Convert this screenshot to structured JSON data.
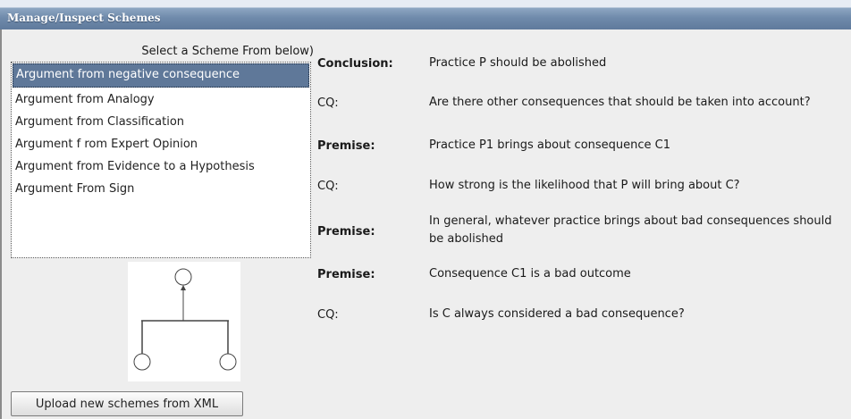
{
  "window": {
    "title": "Manage/Inspect Schemes"
  },
  "scheme_list": {
    "label": "Select a Scheme From below)",
    "items": [
      "Argument from negative consequence",
      "Argument from Analogy",
      "Argument from Classification",
      "Argument f rom Expert Opinion",
      "Argument from Evidence to a Hypothesis",
      "Argument From Sign"
    ],
    "selected_index": 0
  },
  "upload_button": {
    "label": "Upload new schemes from XML"
  },
  "scheme_details": [
    {
      "label": "Conclusion:",
      "text": "Practice P should be abolished",
      "bold": true
    },
    {
      "label": "CQ:",
      "text": "Are there other consequences that should be taken into account?",
      "bold": false
    },
    {
      "label": "Premise:",
      "text": "Practice P1 brings about consequence C1",
      "bold": true
    },
    {
      "label": "CQ:",
      "text": "How strong is the likelihood that P will bring about C?",
      "bold": false
    },
    {
      "label": "Premise:",
      "text": "In general, whatever practice brings about bad consequences should be abolished",
      "bold": true
    },
    {
      "label": "Premise:",
      "text": "Consequence C1 is a bad outcome",
      "bold": true
    },
    {
      "label": "CQ:",
      "text": "Is C always considered a  bad consequence?",
      "bold": false
    }
  ],
  "colors": {
    "selection": "#5f7899",
    "titlebar": "#6f8aab"
  }
}
